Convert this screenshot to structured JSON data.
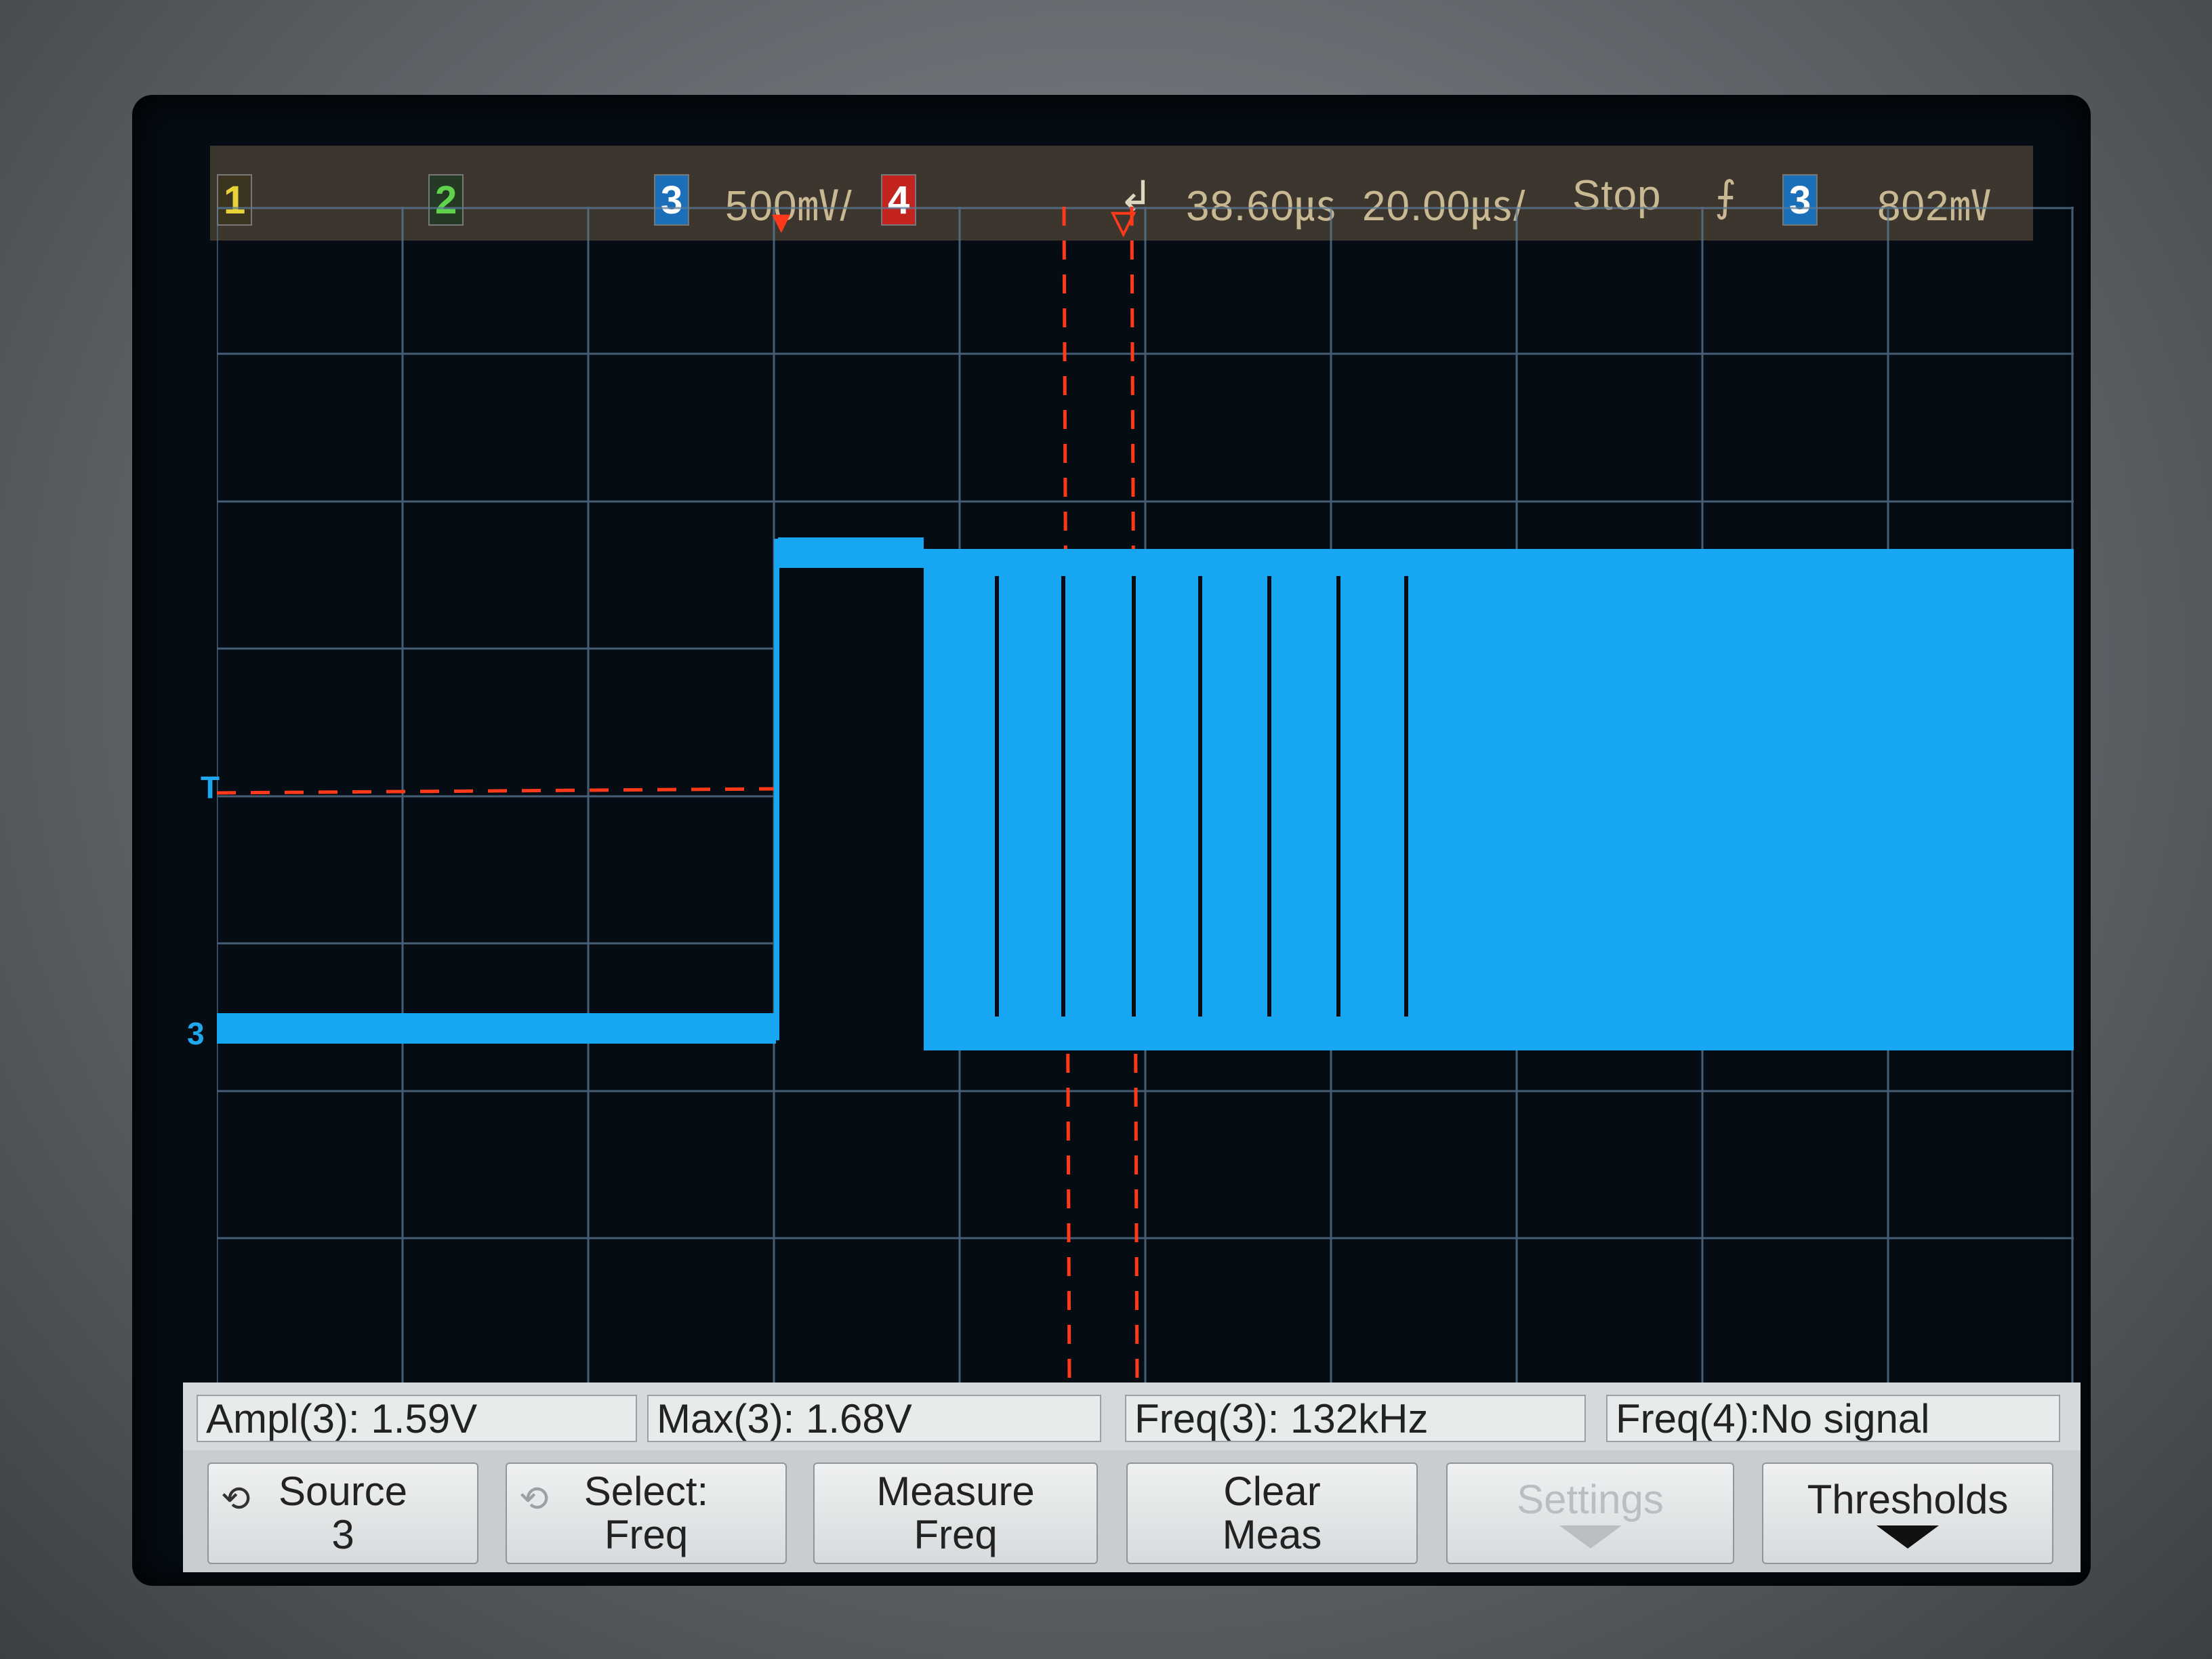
{
  "topbar": {
    "ch1": "1",
    "ch2": "2",
    "ch3": "3",
    "scale": "500㎷/",
    "ch4": "4",
    "delay": "38.60㎲",
    "timebase": "20.00㎲/",
    "run_state": "Stop",
    "trig_icon": "rising-edge-icon",
    "trig_src": "3",
    "trig_level": "802㎷"
  },
  "markers": {
    "trigger_level": "T",
    "ch3_ground": "3"
  },
  "measurements": [
    {
      "label": "Ampl(3): 1.59V"
    },
    {
      "label": "Max(3): 1.68V"
    },
    {
      "label": "Freq(3): 132kHz"
    },
    {
      "label": "Freq(4):No signal"
    }
  ],
  "softkeys": [
    {
      "line1": "Source",
      "line2": "3",
      "icon": "rotate-knob-icon",
      "enabled": true
    },
    {
      "line1": "Select:",
      "line2": "Freq",
      "icon": "rotate-knob-icon",
      "enabled": true
    },
    {
      "line1": "Measure",
      "line2": "Freq",
      "enabled": true
    },
    {
      "line1": "Clear",
      "line2": "Meas",
      "enabled": true
    },
    {
      "line1": "Settings",
      "line2": "",
      "icon": "down-arrow-icon",
      "enabled": false
    },
    {
      "line1": "Thresholds",
      "line2": "",
      "icon": "down-arrow-icon",
      "enabled": true
    }
  ],
  "colors": {
    "ch1": "#e8d23a",
    "ch2": "#5fd34b",
    "ch3": "#1fa8ee",
    "ch4": "#e8302a",
    "trace": "#16a6f2",
    "cursor": "#ff3a1a",
    "grid": "#5c7a96"
  }
}
